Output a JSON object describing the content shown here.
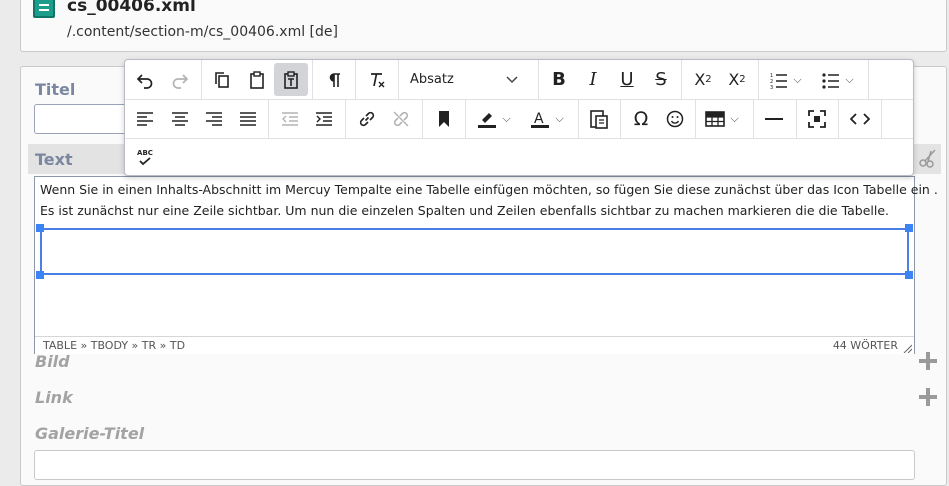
{
  "header": {
    "file_name": "cs_00406.xml",
    "file_path": "/.content/section-m/cs_00406.xml [de]"
  },
  "form": {
    "titel_label": "Titel",
    "text_label": "Text",
    "bild_label": "Bild",
    "link_label": "Link",
    "galerie_label": "Galerie-Titel"
  },
  "toolbar": {
    "paragraph_format": "Absatz",
    "spellcheck_label": "ABC"
  },
  "editor": {
    "line1": "Wenn Sie in einen Inhalts-Abschnitt im Mercuy Tempalte eine Tabelle einfügen möchten, so fügen Sie diese zunächst über das Icon Tabelle ein .",
    "line2": "Es ist zunächst nur eine Zeile sichtbar. Um nun die einzelen Spalten und Zeilen ebenfalls sichtbar  zu machen markieren die die Tabelle.",
    "status_path": "TABLE » TBODY » TR » TD",
    "word_count": "44 WÖRTER"
  },
  "colors": {
    "selection_blue": "#3c83f5",
    "label_blue_grey": "#7b86a0"
  }
}
